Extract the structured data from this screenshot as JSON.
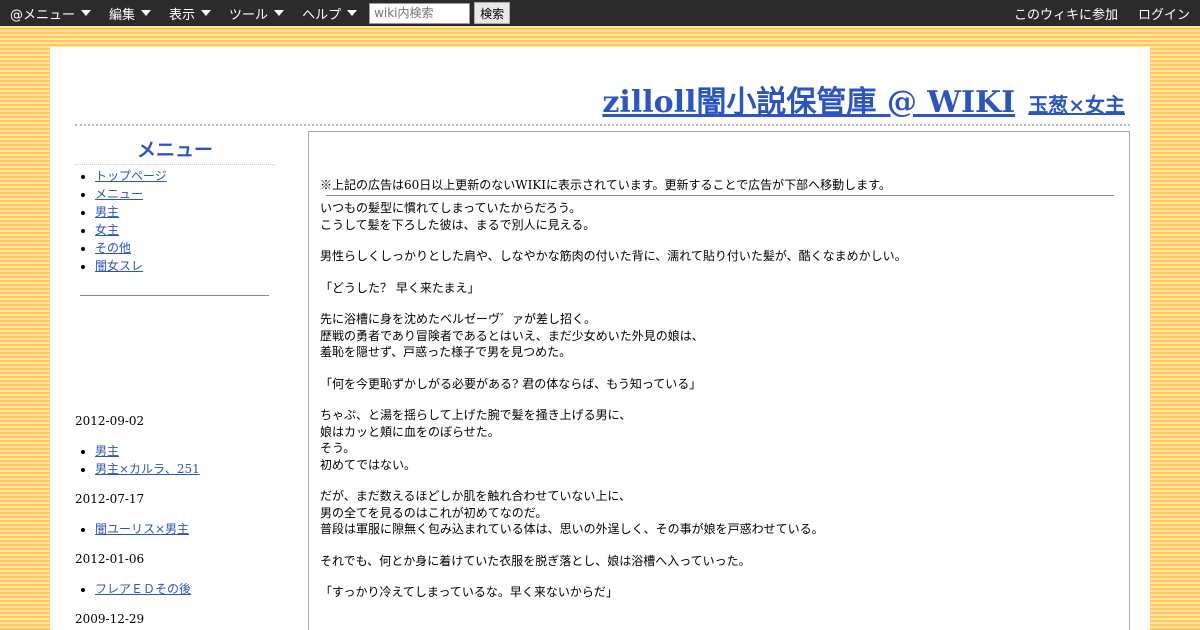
{
  "topbar": {
    "menus": [
      "@メニュー",
      "編集",
      "表示",
      "ツール",
      "ヘルプ"
    ],
    "search_placeholder": "wiki内検索",
    "search_button": "検索",
    "join_label": "このウィキに参加",
    "login_label": "ログイン"
  },
  "header": {
    "site_title": "zilloll闇小説保管庫 @ WIKI",
    "page_title": "玉葱×女主"
  },
  "sidebar": {
    "menu_title": "メニュー",
    "items": [
      "トップページ",
      "メニュー",
      "男主",
      "女主",
      "その他",
      "闇女スレ"
    ]
  },
  "recent": [
    {
      "date": "2012-09-02",
      "pages": [
        "男主",
        "男主×カルラ、251"
      ]
    },
    {
      "date": "2012-07-17",
      "pages": [
        "闇ユーリス×男主"
      ]
    },
    {
      "date": "2012-01-06",
      "pages": [
        "フレアＥＤその後"
      ]
    },
    {
      "date": "2009-12-29",
      "pages": []
    }
  ],
  "main": {
    "ad_notice": "※上記の広告は60日以上更新のないWIKIに表示されています。更新することで広告が下部へ移動します。",
    "paragraphs": [
      [
        "いつもの髪型に慣れてしまっていたからだろう。",
        "こうして髪を下ろした彼は、まるで別人に見える。"
      ],
      [
        "男性らしくしっかりとした肩や、しなやかな筋肉の付いた背に、濡れて貼り付いた髪が、酷くなまめかしい。"
      ],
      [
        "「どうした？ 早く来たまえ」"
      ],
      [
        "先に浴槽に身を沈めたベルゼーヴ゛ァが差し招く。",
        "歴戦の勇者であり冒険者であるとはいえ、まだ少女めいた外見の娘は、",
        "羞恥を隠せず、戸惑った様子で男を見つめた。"
      ],
      [
        "「何を今更恥ずかしがる必要がある? 君の体ならば、もう知っている」"
      ],
      [
        "ちゃぷ、と湯を揺らして上げた腕で髪を掻き上げる男に、",
        "娘はカッと頬に血をのぼらせた。",
        "そう。",
        "初めてではない。"
      ],
      [
        "だが、まだ数えるほどしか肌を触れ合わせていない上に、",
        "男の全てを見るのはこれが初めてなのだ。",
        "普段は軍服に隙無く包み込まれている体は、思いの外逞しく、その事が娘を戸惑わせている。"
      ],
      [
        "それでも、何とか身に着けていた衣服を脱ぎ落とし、娘は浴槽へ入っていった。"
      ],
      [
        "「すっかり冷えてしまっているな。早く来ないからだ」"
      ]
    ]
  }
}
